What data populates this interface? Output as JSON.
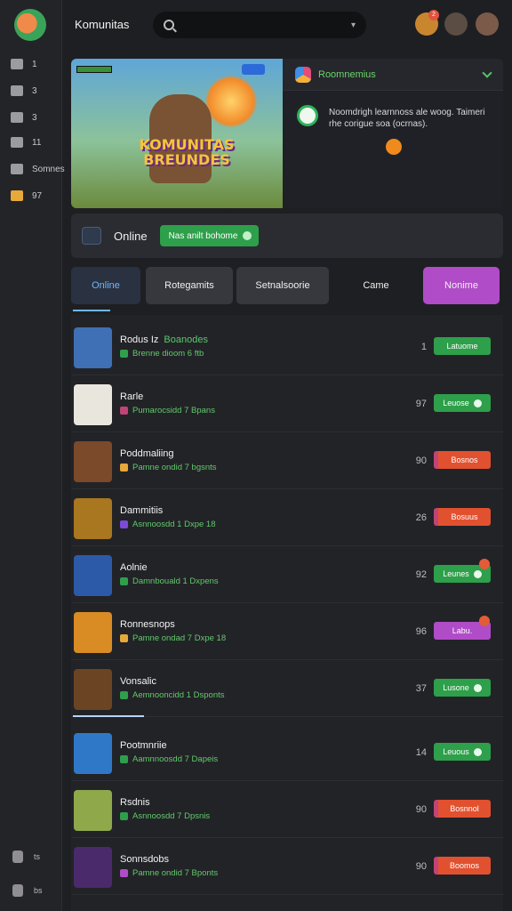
{
  "app": {
    "title": "Komunitas"
  },
  "search": {
    "placeholder": "",
    "tail": "▾"
  },
  "header": {
    "notification_count": "2"
  },
  "sidebar": {
    "items": [
      {
        "label": "1",
        "icon": "home-icon"
      },
      {
        "label": "3",
        "icon": "inbox-icon"
      },
      {
        "label": "3",
        "icon": "chat-icon"
      },
      {
        "label": "11",
        "icon": "mail-icon"
      },
      {
        "label": "Somnes",
        "icon": "user-icon"
      },
      {
        "label": "97",
        "icon": "trophy-icon"
      }
    ],
    "footer": [
      {
        "label": "ts",
        "icon": "shield-icon"
      },
      {
        "label": "bs",
        "icon": "settings-icon"
      }
    ]
  },
  "hero": {
    "game_title": "KOMUNITAS BREUNDES",
    "panel_title": "Roomnemius",
    "message": "Noomdrigh learnnoss ale woog. Taimeri rhe corigue soa (ocrnas).",
    "accent": "#2fb35a"
  },
  "online_bar": {
    "label": "Online",
    "button_label": "Nas anilt bohome"
  },
  "tabs": [
    {
      "label": "Online",
      "active": true
    },
    {
      "label": "Rotegamits"
    },
    {
      "label": "Setnalsoorie"
    },
    {
      "label": "Came"
    },
    {
      "label": "Nonime"
    }
  ],
  "list": [
    {
      "name": "Rodus Iz",
      "tag": "Boanodes",
      "sub": "Brenne dioom 6 ftb",
      "count": "1",
      "button": "Latuome",
      "style": "green",
      "thumb": "#3f6fb5"
    },
    {
      "name": "Rarle",
      "tag": "",
      "sub": "Pumarocsidd 7 Bpans",
      "count": "97",
      "button": "Leuose",
      "style": "green",
      "thumb": "#e9e6dd"
    },
    {
      "name": "Poddmaliing",
      "tag": "",
      "sub": "Pamne ondid 7 bgsnts",
      "count": "90",
      "button": "Bosnos",
      "style": "red",
      "thumb": "#7b4a2a"
    },
    {
      "name": "Dammitiis",
      "tag": "",
      "sub": "Asnnoosdd 1 Dxpe 18",
      "count": "26",
      "button": "Bosuus",
      "style": "red",
      "thumb": "#a8771f"
    },
    {
      "name": "Aolnie",
      "tag": "",
      "sub": "Damnbouald 1 Dxpens",
      "count": "92",
      "button": "Leunes",
      "style": "green",
      "thumb": "#2d5aa8",
      "badge": true
    },
    {
      "name": "Ronnesnops",
      "tag": "",
      "sub": "Pamne ondad 7 Dxpe 18",
      "count": "96",
      "button": "Labu.",
      "style": "purple",
      "thumb": "#d98b24",
      "badge": true
    },
    {
      "name": "Vonsalic",
      "tag": "",
      "sub": "Aemnooncidd 1 Dsponts",
      "count": "37",
      "button": "Lusone",
      "style": "green",
      "thumb": "#6b4423"
    },
    {
      "name": "Pootmnriie",
      "tag": "",
      "sub": "Aamnnoosdd 7 Dapeis",
      "count": "14",
      "button": "Leuous",
      "style": "green",
      "thumb": "#2f78c8"
    },
    {
      "name": "Rsdnis",
      "tag": "",
      "sub": "Asnnoosdd 7 Dpsnis",
      "count": "90",
      "button": "Bosnnol",
      "style": "red",
      "thumb": "#8fa84a"
    },
    {
      "name": "Sonnsdobs",
      "tag": "",
      "sub": "Pamne ondid 7 Bponts",
      "count": "90",
      "button": "Boomos",
      "style": "red",
      "thumb": "#4a2a6b"
    }
  ]
}
